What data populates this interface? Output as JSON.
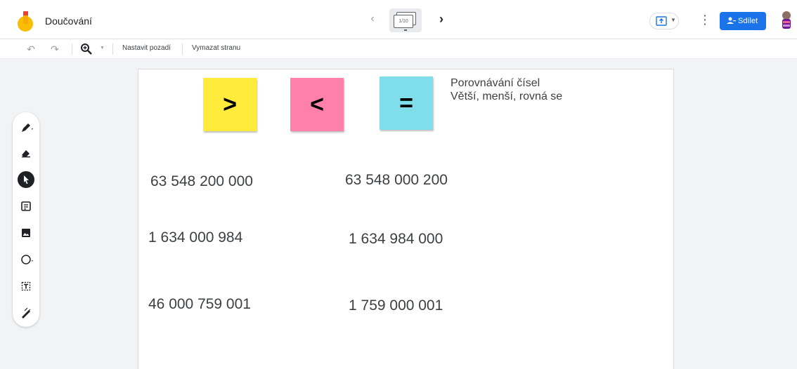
{
  "app": {
    "title": "Doučování"
  },
  "topbar": {
    "frame_indicator": "1/10",
    "prev_icon": "chevron-left-icon",
    "next_icon": "chevron-right-icon",
    "present_icon": "present-icon",
    "more_icon": "more-vert-icon",
    "share_label": "Sdílet",
    "share_icon": "person-add-icon",
    "brand_color": "#1a73e8",
    "logo_colors": [
      "#f9ab00",
      "#fbbc04",
      "#ea4335"
    ]
  },
  "toolbar": {
    "set_background_label": "Nastavit pozadí",
    "clear_page_label": "Vymazat stranu",
    "undo_icon": "undo-icon",
    "redo_icon": "redo-icon",
    "zoom_icon": "zoom-in-icon"
  },
  "palette": {
    "tools": [
      {
        "name": "pen-icon",
        "active": false
      },
      {
        "name": "eraser-icon",
        "active": false
      },
      {
        "name": "select-arrow-icon",
        "active": true
      },
      {
        "name": "sticky-note-icon",
        "active": false
      },
      {
        "name": "image-icon",
        "active": false
      },
      {
        "name": "circle-shape-icon",
        "active": false
      },
      {
        "name": "text-box-icon",
        "active": false
      },
      {
        "name": "laser-pointer-icon",
        "active": false
      }
    ]
  },
  "canvas": {
    "stickies": [
      {
        "symbol": ">",
        "color": "#ffeb3b"
      },
      {
        "symbol": "<",
        "color": "#ff80ab"
      },
      {
        "symbol": "=",
        "color": "#80deea"
      }
    ],
    "title_line1": "Porovnávání čísel",
    "title_line2": "Větší, menší, rovná se",
    "numbers": [
      "63 548 200 000",
      "63 548 000 200",
      "1 634 000 984",
      "1 634 984 000",
      "46 000 759 001",
      "1 759 000 001"
    ]
  }
}
